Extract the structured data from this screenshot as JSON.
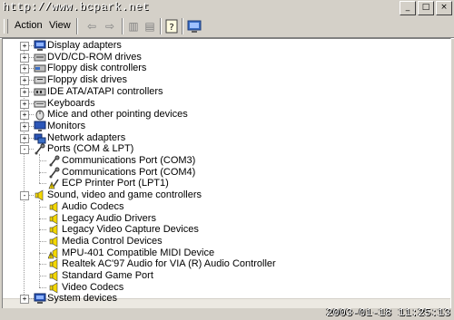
{
  "watermark": "http://www.bcpark.net",
  "window_controls": [
    "_",
    "□",
    "×"
  ],
  "menu": {
    "action": "Action",
    "view": "View"
  },
  "toolbar_icons": [
    "back-arrow-icon",
    "forward-arrow-icon",
    "show-hide-console-tree-icon",
    "properties-icon",
    "help-icon",
    "scan-hardware-icon"
  ],
  "tree": [
    {
      "label": "Display adapters",
      "level": 0,
      "expander": "+",
      "icon": "display-adapter-icon"
    },
    {
      "label": "DVD/CD-ROM drives",
      "level": 0,
      "expander": "+",
      "icon": "cdrom-icon"
    },
    {
      "label": "Floppy disk controllers",
      "level": 0,
      "expander": "+",
      "icon": "floppy-controller-icon"
    },
    {
      "label": "Floppy disk drives",
      "level": 0,
      "expander": "+",
      "icon": "floppy-drive-icon"
    },
    {
      "label": "IDE ATA/ATAPI controllers",
      "level": 0,
      "expander": "+",
      "icon": "ide-controller-icon"
    },
    {
      "label": "Keyboards",
      "level": 0,
      "expander": "+",
      "icon": "keyboard-icon"
    },
    {
      "label": "Mice and other pointing devices",
      "level": 0,
      "expander": "+",
      "icon": "mouse-icon"
    },
    {
      "label": "Monitors",
      "level": 0,
      "expander": "+",
      "icon": "monitor-icon"
    },
    {
      "label": "Network adapters",
      "level": 0,
      "expander": "+",
      "icon": "network-adapter-icon"
    },
    {
      "label": "Ports (COM & LPT)",
      "level": 0,
      "expander": "-",
      "icon": "port-icon"
    },
    {
      "label": "Communications Port (COM3)",
      "level": 1,
      "expander": "",
      "icon": "port-icon"
    },
    {
      "label": "Communications Port (COM4)",
      "level": 1,
      "expander": "",
      "icon": "port-icon"
    },
    {
      "label": "ECP Printer Port (LPT1)",
      "level": 1,
      "expander": "",
      "icon": "warning-port-icon"
    },
    {
      "label": "Sound, video and game controllers",
      "level": 0,
      "expander": "-",
      "icon": "speaker-icon"
    },
    {
      "label": "Audio Codecs",
      "level": 1,
      "expander": "",
      "icon": "speaker-icon"
    },
    {
      "label": "Legacy Audio Drivers",
      "level": 1,
      "expander": "",
      "icon": "speaker-icon"
    },
    {
      "label": "Legacy Video Capture Devices",
      "level": 1,
      "expander": "",
      "icon": "speaker-icon"
    },
    {
      "label": "Media Control Devices",
      "level": 1,
      "expander": "",
      "icon": "speaker-icon"
    },
    {
      "label": "MPU-401 Compatible MIDI Device",
      "level": 1,
      "expander": "",
      "icon": "warning-speaker-icon"
    },
    {
      "label": "Realtek AC'97 Audio for VIA (R) Audio Controller",
      "level": 1,
      "expander": "",
      "icon": "speaker-icon"
    },
    {
      "label": "Standard Game Port",
      "level": 1,
      "expander": "",
      "icon": "speaker-icon"
    },
    {
      "label": "Video Codecs",
      "level": 1,
      "expander": "",
      "icon": "speaker-icon"
    },
    {
      "label": "System devices",
      "level": 0,
      "expander": "+",
      "icon": "system-devices-icon"
    }
  ],
  "timestamp": "2003-01-18 11:25:13",
  "colors": {
    "window": "#d4d0c8",
    "tree_bg": "#ffffff",
    "warning": "#f5d800",
    "text": "#000000"
  }
}
